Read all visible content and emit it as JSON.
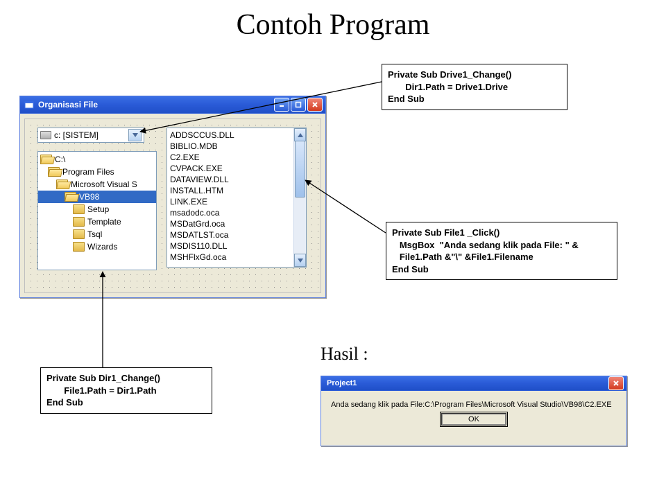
{
  "title": "Contoh Program",
  "code_drive": "Private Sub Drive1_Change()\n       Dir1.Path = Drive1.Drive\nEnd Sub",
  "code_file": "Private Sub File1 _Click()\n   MsgBox  \"Anda sedang klik pada File: \" &\n   File1.Path &\"\\\" &File1.Filename\nEnd Sub",
  "code_dir": "Private Sub Dir1_Change()\n       File1.Path = Dir1.Path\nEnd Sub",
  "hasil_label": "Hasil :",
  "vb_window": {
    "title": "Organisasi File",
    "drive": "c: [SISTEM]",
    "dirs": [
      {
        "label": "C:\\",
        "indent": 0,
        "open": true,
        "selected": false
      },
      {
        "label": "Program Files",
        "indent": 1,
        "open": true,
        "selected": false
      },
      {
        "label": "Microsoft Visual S",
        "indent": 2,
        "open": true,
        "selected": false
      },
      {
        "label": "VB98",
        "indent": 3,
        "open": true,
        "selected": true
      },
      {
        "label": "Setup",
        "indent": 4,
        "open": false,
        "selected": false
      },
      {
        "label": "Template",
        "indent": 4,
        "open": false,
        "selected": false
      },
      {
        "label": "Tsql",
        "indent": 4,
        "open": false,
        "selected": false
      },
      {
        "label": "Wizards",
        "indent": 4,
        "open": false,
        "selected": false
      }
    ],
    "files": [
      "ADDSCCUS.DLL",
      "BIBLIO.MDB",
      "C2.EXE",
      "CVPACK.EXE",
      "DATAVIEW.DLL",
      "INSTALL.HTM",
      "LINK.EXE",
      "msadodc.oca",
      "MSDatGrd.oca",
      "MSDATLST.oca",
      "MSDIS110.DLL",
      "MSHFlxGd.oca"
    ]
  },
  "msgbox": {
    "title": "Project1",
    "text": "Anda sedang klik pada File:C:\\Program Files\\Microsoft Visual Studio\\VB98\\C2.EXE",
    "ok": "OK"
  }
}
